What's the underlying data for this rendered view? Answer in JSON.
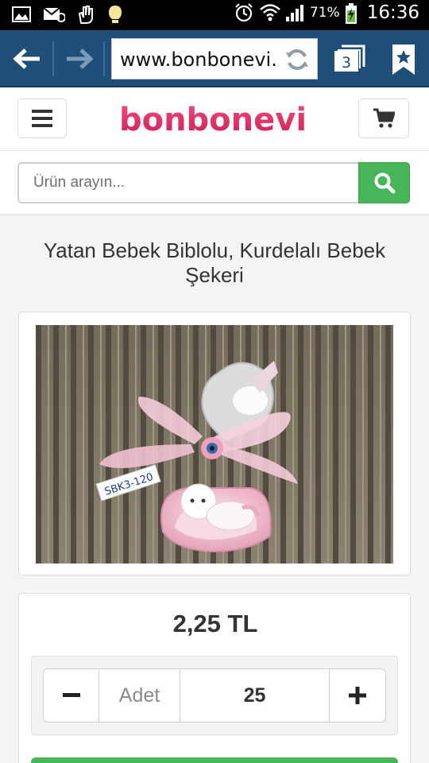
{
  "status_bar": {
    "battery_percent": "71%",
    "clock": "16:36",
    "icons": [
      "image-icon",
      "mail-icon",
      "hand-icon",
      "bulb-icon",
      "alarm-icon",
      "wifi-icon",
      "signal-icon",
      "battery-charging-icon"
    ]
  },
  "browser": {
    "url": "www.bonbonevi.",
    "tab_count": "3",
    "icons": [
      "back-arrow-icon",
      "forward-arrow-icon",
      "refresh-icon",
      "tabs-icon",
      "bookmark-star-icon"
    ]
  },
  "header": {
    "logo_text": "bonbonevi",
    "brand_color": "#e0245e",
    "icons": [
      "hamburger-menu-icon",
      "cart-icon"
    ]
  },
  "search": {
    "placeholder": "Ürün arayın...",
    "button_color": "#47b559",
    "icon": "search-icon"
  },
  "product": {
    "title": "Yatan Bebek Biblolu, Kurdelalı Bebek Şekeri",
    "image_tag": "SBK3-120",
    "price": "2,25 TL"
  },
  "quantity": {
    "minus_symbol": "−",
    "label": "Adet",
    "value": "25",
    "plus_symbol": "+"
  }
}
